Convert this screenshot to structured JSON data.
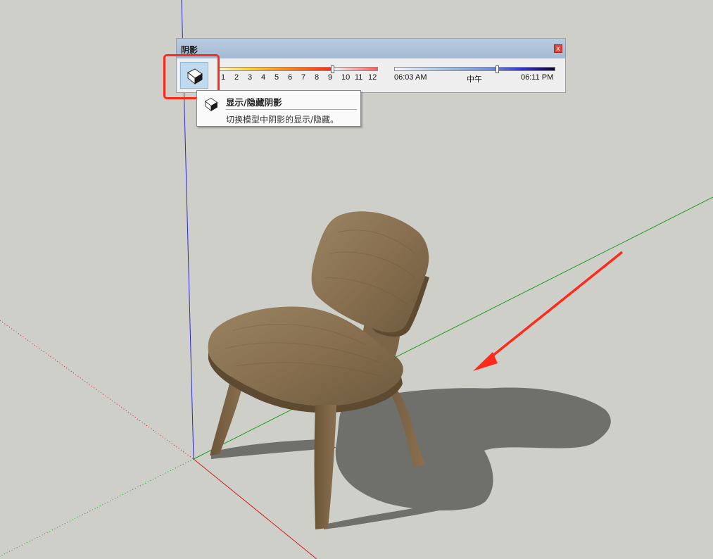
{
  "panel": {
    "title": "阴影",
    "close_label": "x",
    "toggle_icon": "shadow-toggle-icon",
    "months": [
      "1",
      "2",
      "3",
      "4",
      "5",
      "6",
      "7",
      "8",
      "9",
      "10",
      "11",
      "12"
    ],
    "selected_month": 9,
    "time_labels": {
      "start": "06:03 AM",
      "mid": "中午",
      "end": "06:11 PM"
    },
    "selected_time_fraction": 0.63
  },
  "tooltip": {
    "title": "显示/隐藏阴影",
    "description": "切换模型中阴影的显示/隐藏。"
  },
  "scene": {
    "background": "#cfcfca",
    "axis_colors": {
      "blue": "#2a2ad0",
      "green": "#1f9a1f",
      "red": "#cc1f1f"
    },
    "annotation_color": "#ff2a1a",
    "model": "wooden-chair",
    "shadow_color": "#6f6f6c"
  }
}
